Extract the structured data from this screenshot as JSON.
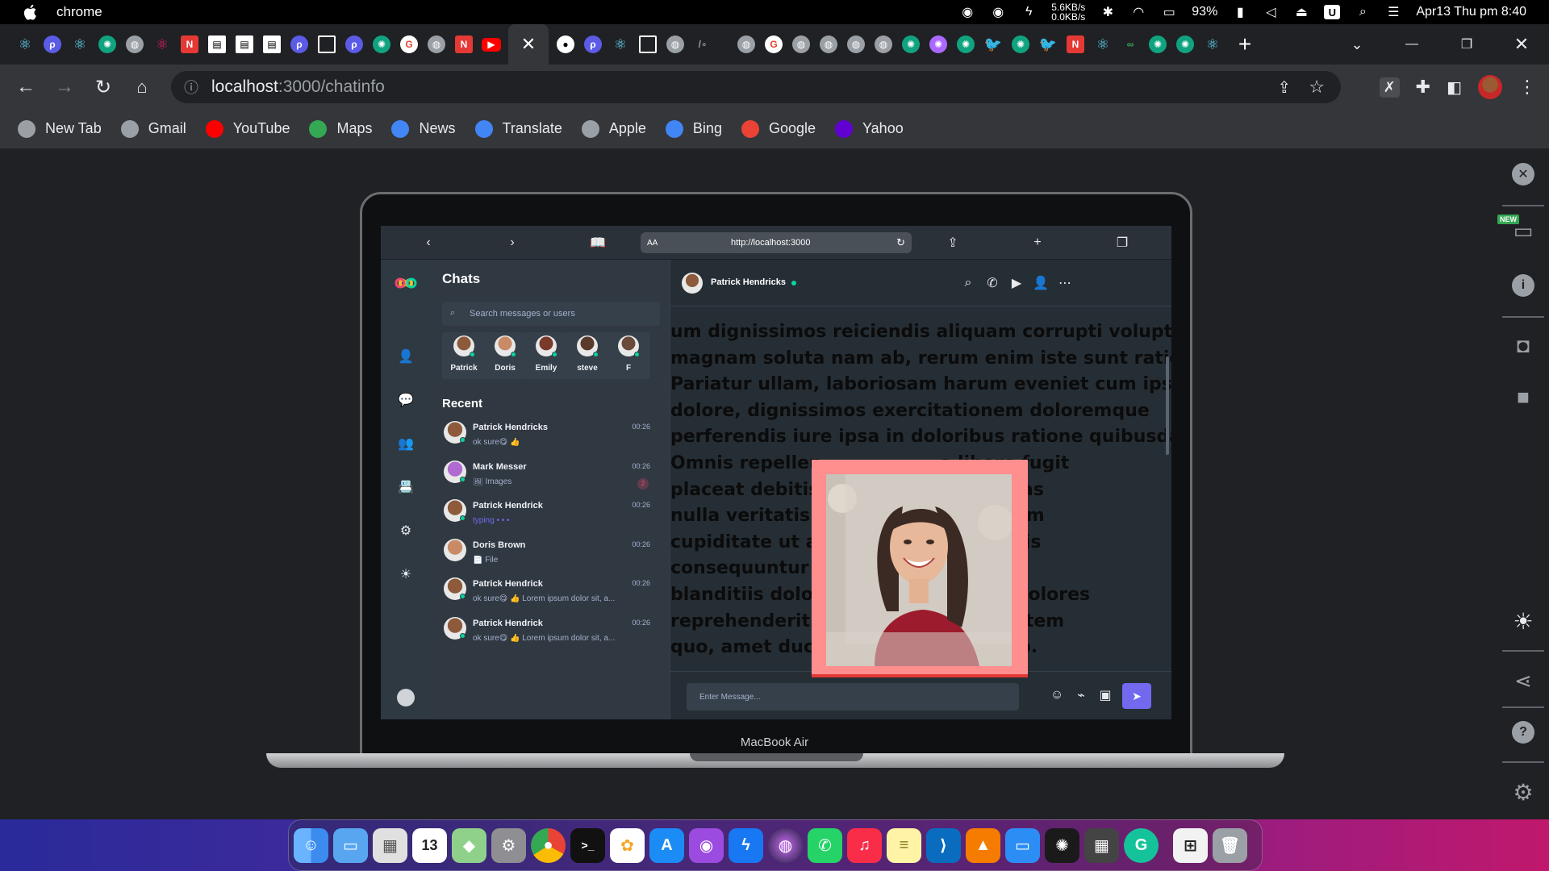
{
  "menubar": {
    "app_name": "chrome",
    "net_up": "5.6KB/s",
    "net_down": "0.0KB/s",
    "battery": "93%",
    "clock": "Apr13 Thu pm 8:40"
  },
  "tabs": {
    "count_hint": "many pinned favicon tabs",
    "new_tab_label": "+"
  },
  "toolbar": {
    "url_host": "localhost",
    "url_path": ":3000/chatinfo"
  },
  "bookmarks": [
    {
      "label": "New Tab",
      "icon": "globe-icon",
      "color": "#9aa0a6"
    },
    {
      "label": "Gmail",
      "icon": "globe-icon",
      "color": "#9aa0a6"
    },
    {
      "label": "YouTube",
      "icon": "youtube-icon",
      "color": "#ff0000"
    },
    {
      "label": "Maps",
      "icon": "maps-icon",
      "color": "#34a853"
    },
    {
      "label": "News",
      "icon": "news-icon",
      "color": "#4285f4"
    },
    {
      "label": "Translate",
      "icon": "translate-icon",
      "color": "#4285f4"
    },
    {
      "label": "Apple",
      "icon": "apple-icon",
      "color": "#9aa0a6"
    },
    {
      "label": "Bing",
      "icon": "search-icon",
      "color": "#4285f4"
    },
    {
      "label": "Google",
      "icon": "google-icon",
      "color": "#ea4335"
    },
    {
      "label": "Yahoo",
      "icon": "yahoo-icon",
      "color": "#6001d2"
    }
  ],
  "macbook": {
    "label": "MacBook Air",
    "safari_url": "http://localhost:3000",
    "safari_aa": "AA"
  },
  "chat_app": {
    "title": "Chats",
    "search_placeholder": "Search messages or users",
    "online_users": [
      "Patrick",
      "Doris",
      "Emily",
      "steve",
      "F"
    ],
    "recent_title": "Recent",
    "conversations": [
      {
        "name": "Patrick Hendricks",
        "message": "ok sure😋 👍",
        "time": "00:26",
        "online": true
      },
      {
        "name": "Mark Messer",
        "message": "🖼 Images",
        "time": "00:26",
        "online": true,
        "badge": "2"
      },
      {
        "name": "Patrick Hendrick",
        "message": "typing • • •",
        "time": "00:26",
        "online": true,
        "typing": true
      },
      {
        "name": "Doris Brown",
        "message": "📄 File",
        "time": "00:26",
        "online": false
      },
      {
        "name": "Patrick Hendrick",
        "message": "ok sure😋 👍  Lorem ipsum dolor sit, a...",
        "time": "00:26",
        "online": true
      },
      {
        "name": "Patrick Hendrick",
        "message": "ok sure😋 👍  Lorem ipsum dolor sit, a...",
        "time": "00:26",
        "online": true
      }
    ],
    "active_chat": {
      "name": "Patrick Hendricks",
      "status_color": "#06d6a0"
    },
    "body_text": "um dignissimos reiciendis aliquam corrupti voluptas magnam soluta nam ab, rerum enim iste sunt ratione? Pariatur ullam, laboriosam harum eveniet cum ipsam dolore, dignissimos exercitationem doloremque perferendis iure ipsa in doloribus ratione quibusdam! Omnis repellen... libero fugit placeat debitis ...ui vel alias nulla veritatis e...aesentium cupiditate ut al...tum nobis consequuntur n...eritatis blanditiis dolor...i illo ut dolores reprehenderit n...ndis autem quo, amet duci...istinctio.",
    "lines": [
      "um dignissimos reiciendis aliquam corrupti voluptas",
      "magnam soluta nam ab, rerum enim iste sunt ratione?",
      "Pariatur ullam, laboriosam harum eveniet cum ipsam",
      "dolore, dignissimos exercitationem doloremque",
      "perferendis iure ipsa in doloribus ratione quibusdam!",
      "Omnis repellen                   o libero fugit",
      "placeat debitis                   ui vel alias",
      "nulla veritatis e                  aesentium",
      "cupiditate ut al                   tum nobis",
      "consequuntur n                    eritatis",
      "blanditiis dolor                   i illo ut dolores",
      "reprehenderit n                    ndis autem",
      "quo, amet duci                     istinctio."
    ],
    "composer_placeholder": "Enter Message..."
  },
  "side_panel": {
    "new_badge": "NEW"
  },
  "colors": {
    "accent": "#7269ef",
    "online": "#06d6a0",
    "popup_bg": "#ff8e8e"
  }
}
